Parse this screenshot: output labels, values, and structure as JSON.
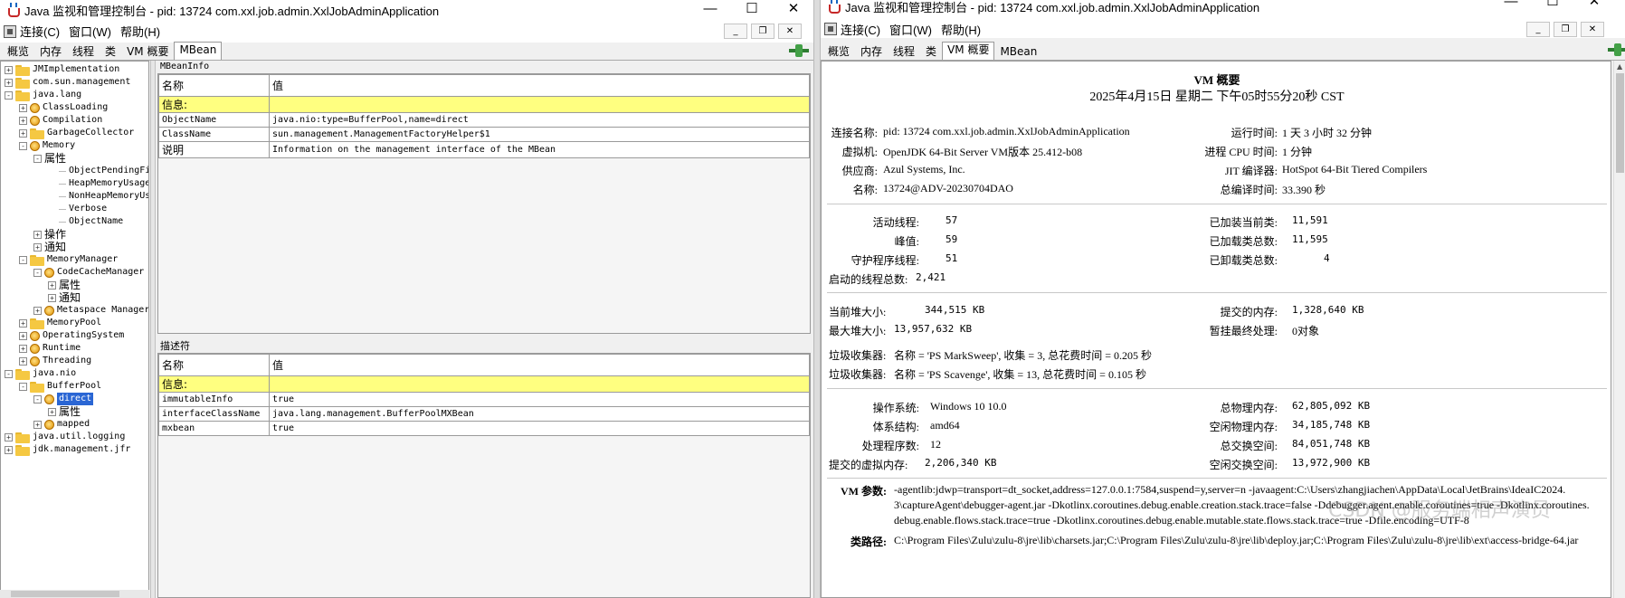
{
  "left": {
    "title": "Java 监视和管理控制台 - pid: 13724 com.xxl.job.admin.XxlJobAdminApplication",
    "window_controls": [
      "—",
      "☐",
      "✕"
    ],
    "menu": [
      "连接(C)",
      "窗口(W)",
      "帮助(H)"
    ],
    "mdi_controls": [
      "_",
      "❐",
      "✕"
    ],
    "tabs": [
      "概览",
      "内存",
      "线程",
      "类",
      "VM 概要",
      "MBean"
    ],
    "selected_tab": "MBean",
    "tree": [
      {
        "label": "JMImplementation",
        "depth": 0,
        "type": "folder",
        "toggle": "+"
      },
      {
        "label": "com.sun.management",
        "depth": 0,
        "type": "folder",
        "toggle": "+"
      },
      {
        "label": "java.lang",
        "depth": 0,
        "type": "folder",
        "toggle": "-"
      },
      {
        "label": "ClassLoading",
        "depth": 1,
        "type": "bean",
        "toggle": "+"
      },
      {
        "label": "Compilation",
        "depth": 1,
        "type": "bean",
        "toggle": "+"
      },
      {
        "label": "GarbageCollector",
        "depth": 1,
        "type": "folder",
        "toggle": "+"
      },
      {
        "label": "Memory",
        "depth": 1,
        "type": "bean",
        "toggle": "-"
      },
      {
        "label": "属性",
        "depth": 2,
        "type": "text",
        "toggle": "-"
      },
      {
        "label": "ObjectPendingFinal",
        "depth": 3,
        "type": "leaf",
        "toggle": ""
      },
      {
        "label": "HeapMemoryUsage",
        "depth": 3,
        "type": "leaf",
        "toggle": ""
      },
      {
        "label": "NonHeapMemoryUsage",
        "depth": 3,
        "type": "leaf",
        "toggle": ""
      },
      {
        "label": "Verbose",
        "depth": 3,
        "type": "leaf",
        "toggle": ""
      },
      {
        "label": "ObjectName",
        "depth": 3,
        "type": "leaf",
        "toggle": ""
      },
      {
        "label": "操作",
        "depth": 2,
        "type": "text",
        "toggle": "+"
      },
      {
        "label": "通知",
        "depth": 2,
        "type": "text",
        "toggle": "+"
      },
      {
        "label": "MemoryManager",
        "depth": 1,
        "type": "folder",
        "toggle": "-"
      },
      {
        "label": "CodeCacheManager",
        "depth": 2,
        "type": "bean",
        "toggle": "-"
      },
      {
        "label": "属性",
        "depth": 3,
        "type": "text",
        "toggle": "+"
      },
      {
        "label": "通知",
        "depth": 3,
        "type": "text",
        "toggle": "+"
      },
      {
        "label": "Metaspace Manager",
        "depth": 2,
        "type": "bean",
        "toggle": "+"
      },
      {
        "label": "MemoryPool",
        "depth": 1,
        "type": "folder",
        "toggle": "+"
      },
      {
        "label": "OperatingSystem",
        "depth": 1,
        "type": "bean",
        "toggle": "+"
      },
      {
        "label": "Runtime",
        "depth": 1,
        "type": "bean",
        "toggle": "+"
      },
      {
        "label": "Threading",
        "depth": 1,
        "type": "bean",
        "toggle": "+"
      },
      {
        "label": "java.nio",
        "depth": 0,
        "type": "folder",
        "toggle": "-"
      },
      {
        "label": "BufferPool",
        "depth": 1,
        "type": "folder",
        "toggle": "-"
      },
      {
        "label": "direct",
        "depth": 2,
        "type": "bean",
        "toggle": "-",
        "selected": true
      },
      {
        "label": "属性",
        "depth": 3,
        "type": "text",
        "toggle": "+"
      },
      {
        "label": "mapped",
        "depth": 2,
        "type": "bean",
        "toggle": "+"
      },
      {
        "label": "java.util.logging",
        "depth": 0,
        "type": "folder",
        "toggle": "+"
      },
      {
        "label": "jdk.management.jfr",
        "depth": 0,
        "type": "folder",
        "toggle": "+"
      }
    ],
    "mbeaninfo": {
      "title": "MBeanInfo",
      "col_name": "名称",
      "col_value": "值",
      "section": "信息:",
      "rows": [
        {
          "name": "ObjectName",
          "value": "java.nio:type=BufferPool,name=direct"
        },
        {
          "name": "ClassName",
          "value": "sun.management.ManagementFactoryHelper$1"
        },
        {
          "name": "说明",
          "value": "Information on the management interface of the MBean"
        }
      ]
    },
    "descriptor": {
      "title": "描述符",
      "col_name": "名称",
      "col_value": "值",
      "section": "信息:",
      "rows": [
        {
          "name": "immutableInfo",
          "value": "true"
        },
        {
          "name": "interfaceClassName",
          "value": "java.lang.management.BufferPoolMXBean"
        },
        {
          "name": "mxbean",
          "value": "true"
        }
      ]
    }
  },
  "right": {
    "title": "Java 监视和管理控制台 - pid: 13724 com.xxl.job.admin.XxlJobAdminApplication",
    "window_controls": [
      "—",
      "☐",
      "✕"
    ],
    "menu": [
      "连接(C)",
      "窗口(W)",
      "帮助(H)"
    ],
    "mdi_controls": [
      "_",
      "❐",
      "✕"
    ],
    "tabs": [
      "概览",
      "内存",
      "线程",
      "类",
      "VM 概要",
      "MBean"
    ],
    "selected_tab": "VM 概要",
    "summary": {
      "heading": "VM 概要",
      "datetime": "2025年4月15日 星期二 下午05时55分20秒 CST",
      "connection_label": "连接名称:",
      "connection_value": "pid: 13724 com.xxl.job.admin.XxlJobAdminApplication",
      "vm_label": "虚拟机:",
      "vm_value": "OpenJDK 64-Bit Server VM版本 25.412-b08",
      "vendor_label": "供应商:",
      "vendor_value": "Azul Systems, Inc.",
      "name_label": "名称:",
      "name_value": "13724@ADV-20230704DAO",
      "uptime_label": "运行时间:",
      "uptime_value": "1 天 3 小时 32 分钟",
      "cpu_label": "进程 CPU 时间:",
      "cpu_value": "1 分钟",
      "jit_label": "JIT 编译器:",
      "jit_value": "HotSpot 64-Bit Tiered Compilers",
      "compile_label": "总编译时间:",
      "compile_value": "33.390 秒",
      "live_threads_label": "活动线程:",
      "live_threads_value": "57",
      "peak_label": "峰值:",
      "peak_value": "59",
      "daemon_label": "守护程序线程:",
      "daemon_value": "51",
      "started_label": "启动的线程总数:",
      "started_value": "2,421",
      "loaded_label": "已加装当前类:",
      "loaded_value": "11,591",
      "total_loaded_label": "已加载类总数:",
      "total_loaded_value": "11,595",
      "unloaded_label": "已卸载类总数:",
      "unloaded_value": "4",
      "heap_label": "当前堆大小:",
      "heap_value": "344,515 KB",
      "max_heap_label": "最大堆大小:",
      "max_heap_value": "13,957,632 KB",
      "committed_label": "提交的内存:",
      "committed_value": "1,328,640 KB",
      "pending_label": "暂挂最终处理:",
      "pending_value": "0对象",
      "gc1_label": "垃圾收集器:",
      "gc1_value": "名称 = 'PS MarkSweep', 收集 = 3, 总花费时间 = 0.205 秒",
      "gc2_label": "垃圾收集器:",
      "gc2_value": "名称 = 'PS Scavenge', 收集 = 13, 总花费时间 = 0.105 秒",
      "os_label": "操作系统:",
      "os_value": "Windows 10 10.0",
      "arch_label": "体系结构:",
      "arch_value": "amd64",
      "procs_label": "处理程序数:",
      "procs_value": "12",
      "vmem_label": "提交的虚拟内存:",
      "vmem_value": "2,206,340 KB",
      "phys_label": "总物理内存:",
      "phys_value": "62,805,092 KB",
      "free_phys_label": "空闲物理内存:",
      "free_phys_value": "34,185,748 KB",
      "swap_label": "总交换空间:",
      "swap_value": "84,051,748 KB",
      "free_swap_label": "空闲交换空间:",
      "free_swap_value": "13,972,900 KB",
      "vmargs_label": "VM 参数:",
      "vmargs_line1": "-agentlib:jdwp=transport=dt_socket,address=127.0.0.1:7584,suspend=y,server=n -javaagent:C:\\Users\\zhangjiachen\\AppData\\Local\\JetBrains\\IdeaIC2024.",
      "vmargs_line2": "3\\captureAgent\\debugger-agent.jar -Dkotlinx.coroutines.debug.enable.creation.stack.trace=false -Ddebugger.agent.enable.coroutines=true -Dkotlinx.coroutines.",
      "vmargs_line3": "debug.enable.flows.stack.trace=true -Dkotlinx.coroutines.debug.enable.mutable.state.flows.stack.trace=true -Dfile.encoding=UTF-8",
      "classpath_label": "类路径:",
      "classpath_partial": "C:\\Program Files\\Zulu\\zulu-8\\jre\\lib\\charsets.jar;C:\\Program Files\\Zulu\\zulu-8\\jre\\lib\\deploy.jar;C:\\Program Files\\Zulu\\zulu-8\\jre\\lib\\ext\\access-bridge-64.jar"
    },
    "watermark": "CSDN @服务端相声演员"
  }
}
